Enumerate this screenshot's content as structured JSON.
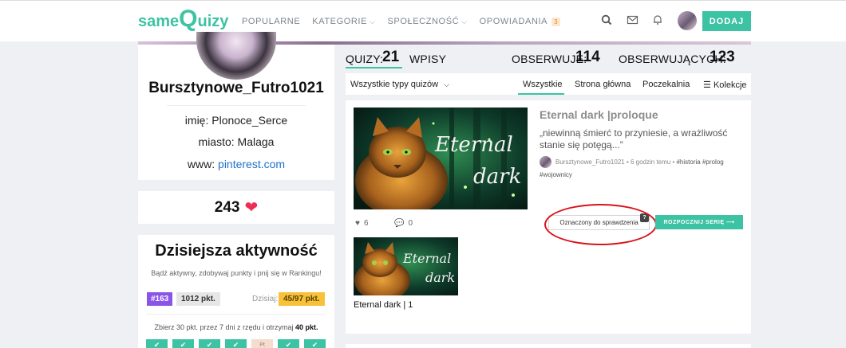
{
  "header": {
    "logo_prefix": "same",
    "logo_q": "Q",
    "logo_suffix": "uizy",
    "nav": [
      {
        "label": "POPULARNE"
      },
      {
        "label": "KATEGORIE",
        "chevron": "chevron-down-icon"
      },
      {
        "label": "SPOŁECZNOŚĆ",
        "chevron": "chevron-down-icon"
      },
      {
        "label": "OPOWIADANIA",
        "badge": "3"
      }
    ],
    "add_button": "DODAJ"
  },
  "profile": {
    "username": "Bursztynowe_Futro1021",
    "name_label": "imię:",
    "name_value": "Plonoce_Serce",
    "city_label": "miasto:",
    "city_value": "Malaga",
    "www_label": "www:",
    "www_value": "pinterest.com",
    "likes": "243"
  },
  "activity": {
    "title": "Dzisiejsza aktywność",
    "subtitle": "Bądź aktywny, zdobywaj punkty i pnij się w Rankingu!",
    "rank": "#163",
    "points": "1012 pkt.",
    "today_label": "Dzisiaj:",
    "today_value": "45/97 pkt.",
    "note_prefix": "Zbierz 30 pkt. przez 7 dni z rzędu i otrzymaj ",
    "note_bold": "40 pkt.",
    "days": [
      "✔",
      "✔",
      "✔",
      "✔",
      "Pt",
      "✔",
      "✔"
    ]
  },
  "stats": {
    "quizy_label": "QUIZY:",
    "quizy_value": "21",
    "wpisy_label": "WPISY",
    "obserwuje_label": "OBSERWUJE:",
    "obserwuje_value": "114",
    "obserwujacych_label": "OBSERWUJĄCYCH:",
    "obserwujacych_value": "123"
  },
  "filters": {
    "type_select": "Wszystkie typy quizów",
    "tabs": [
      "Wszystkie",
      "Strona główna",
      "Poczekalnia",
      "Kolekcje"
    ]
  },
  "quiz": {
    "title": "Eternal dark |proloque",
    "description": "„niewinną śmierć to przyniesie, a wrażliwość stanie się potęgą...”",
    "author": "Bursztynowe_Futro1021",
    "time": "6 godzin temu",
    "tags": [
      "#historia",
      "#prolog",
      "#wojownicy"
    ],
    "likes": "6",
    "comments": "0",
    "flag_label": "Oznaczony do sprawdzenia",
    "flag_help": "?",
    "series_button": "ROZPOCZNIJ SERIĘ ⟶",
    "image_text": "Eternal dark",
    "thumb_label": "Eternal dark | 1"
  },
  "colors": {
    "accent": "#3cc3a3",
    "link": "#1f73c8",
    "rank_badge": "#8a54e8",
    "today_badge": "#f7c23a",
    "heart": "#ef2c55",
    "annotation": "#d8131b"
  }
}
